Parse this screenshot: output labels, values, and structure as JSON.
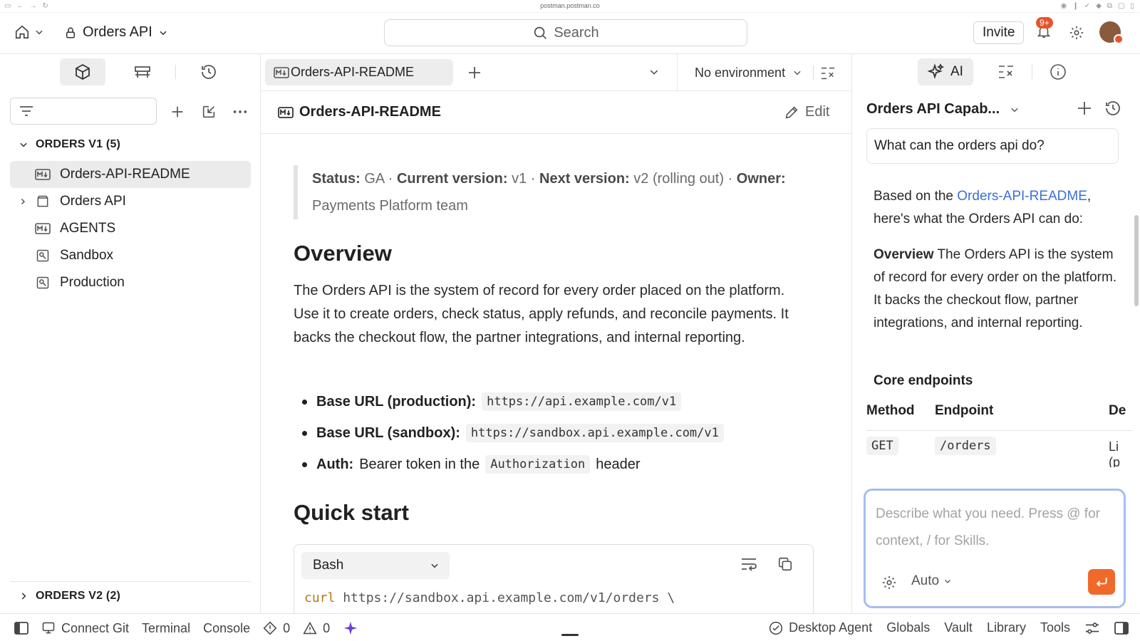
{
  "browser": {
    "url": "postman.postman.co"
  },
  "header": {
    "workspace_name": "Orders API",
    "search_placeholder": "Search",
    "invite_label": "Invite",
    "notification_count": "9+"
  },
  "sidebar": {
    "collection_v1": "ORDERS V1 (5)",
    "collection_v2": "ORDERS V2 (2)",
    "items": [
      {
        "label": "Orders-API-README",
        "icon": "markdown-icon",
        "selected": true
      },
      {
        "label": "Orders API",
        "icon": "folder-icon",
        "expandable": true
      },
      {
        "label": "AGENTS",
        "icon": "markdown-icon"
      },
      {
        "label": "Sandbox",
        "icon": "environment-icon"
      },
      {
        "label": "Production",
        "icon": "environment-icon"
      }
    ]
  },
  "tabs": {
    "active_tab": "Orders-API-README",
    "environment": "No environment"
  },
  "doc": {
    "title": "Orders-API-README",
    "edit_label": "Edit",
    "status_label": "Status:",
    "status_value": "GA",
    "current_version_label": "Current version:",
    "current_version_value": "v1",
    "next_version_label": "Next version:",
    "next_version_value": "v2 (rolling out)",
    "owner_label": "Owner:",
    "owner_value": "Payments Platform team",
    "overview_heading": "Overview",
    "overview_text": "The Orders API is the system of record for every order placed on the platform. Use it to create orders, check status, apply refunds, and reconcile payments. It backs the checkout flow, the partner integrations, and internal reporting.",
    "bullets": [
      {
        "label": "Base URL (production):",
        "code": "https://api.example.com/v1",
        "tail": ""
      },
      {
        "label": "Base URL (sandbox):",
        "code": "https://sandbox.api.example.com/v1",
        "tail": ""
      },
      {
        "label": "Auth:",
        "text": "Bearer token in the",
        "code": "Authorization",
        "tail": "header"
      }
    ],
    "quickstart_heading": "Quick start",
    "code_language": "Bash",
    "code_keyword": "curl",
    "code_line": "https://sandbox.api.example.com/v1/orders \\"
  },
  "ai": {
    "tab_label": "AI",
    "conversation_title": "Orders API Capab...",
    "user_prompt": "What can the orders api do?",
    "answer_intro": "Based on the",
    "answer_link": "Orders-API-README",
    "answer_intro_tail": ", here's what the Orders API can do:",
    "answer_overview_label": "Overview",
    "answer_overview_text": "The Orders API is the system of record for every order on the platform. It backs the checkout flow, partner integrations, and internal reporting.",
    "core_heading": "Core endpoints",
    "table_headers": [
      "Method",
      "Endpoint",
      "De"
    ],
    "table_rows": [
      {
        "method": "GET",
        "endpoint": "/orders",
        "desc_1": "Li",
        "desc_2": "(p"
      }
    ],
    "composer_placeholder": "Describe what you need. Press @ for context, / for Skills.",
    "mode_label": "Auto"
  },
  "statusbar": {
    "connect_git": "Connect Git",
    "terminal": "Terminal",
    "console": "Console",
    "errors": "0",
    "warnings": "0",
    "desktop_agent": "Desktop Agent",
    "globals": "Globals",
    "vault": "Vault",
    "library": "Library",
    "tools": "Tools"
  },
  "colors": {
    "accent": "#ef6a2a",
    "badge": "#e5542a",
    "link": "#3a6fd8",
    "focus_ring": "#a7bdf0"
  }
}
